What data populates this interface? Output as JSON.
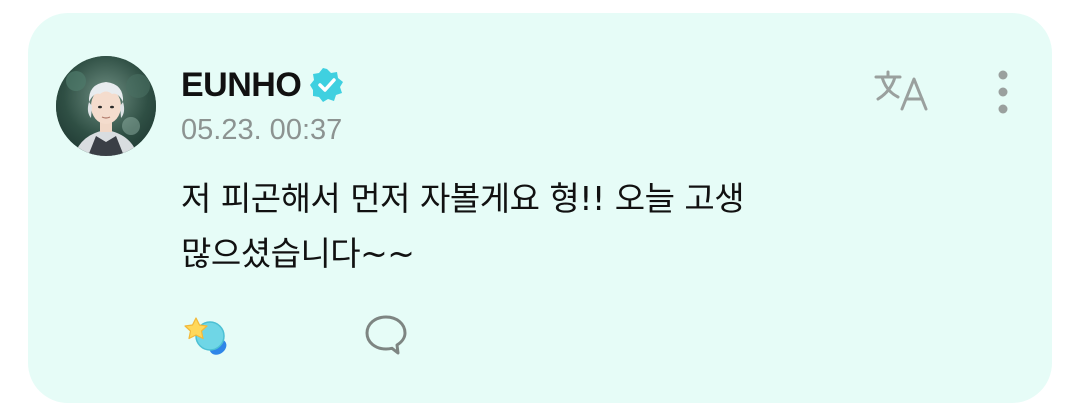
{
  "post": {
    "author": {
      "name": "EUNHO",
      "avatar_icon": "profile-avatar",
      "verified_icon": "verified-badge-icon"
    },
    "timestamp": "05.23. 00:37",
    "text": "저 피곤해서 먼저 자볼게요 형!! 오늘 고생\n많으셨습니다~~",
    "actions": {
      "translate_icon": "translate-icon",
      "more_icon": "more-vertical-icon",
      "reaction_icon": "star-reaction-icon",
      "comment_icon": "comment-bubble-icon"
    }
  },
  "colors": {
    "card_background": "#e6fcf7",
    "verified": "#3fd0e0",
    "muted_icon": "#9aa09e",
    "text": "#111111",
    "timestamp": "#8c9391"
  }
}
